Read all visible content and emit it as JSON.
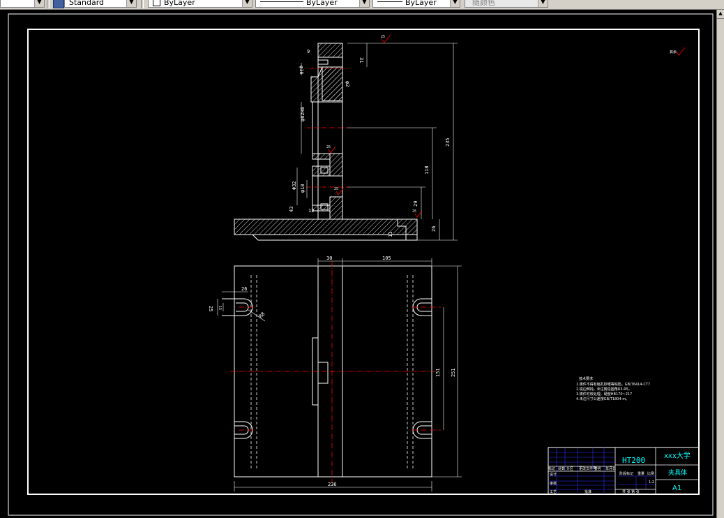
{
  "toolbar": {
    "textstyle_value": "Standard",
    "layer_value": "ByLayer",
    "linetype_value": "ByLayer",
    "lineweight_value": "ByLayer",
    "plotstyle_value": "随颜色"
  },
  "colors": {
    "background": "#000000",
    "frame": "#ffffff",
    "centerline": "#ff0000",
    "titleblock": "#0000ff",
    "text_cyan": "#00ffff",
    "dimension": "#ffffff"
  },
  "drawing": {
    "top_view_dims": {
      "d9": "9",
      "d31": "31",
      "d16": "φ16",
      "d2": "φ2",
      "d62": "φ62H8",
      "d235": "235",
      "d118": "118",
      "d1": "Φ32",
      "d10": "φ10",
      "d29": "29",
      "d43": "43",
      "d12": "12",
      "d26": "26",
      "d11": "11",
      "r25a": "25",
      "r25b": "25",
      "r25c": "25",
      "r25d": "25"
    },
    "bottom_view_dims": {
      "d30": "30",
      "d105": "105",
      "d26": "26",
      "d25": "25",
      "d15": "15",
      "r13": "R8",
      "d151": "151",
      "d251": "251",
      "d236": "236"
    },
    "roughness_label": "其余",
    "notes": {
      "heading": "技术要求",
      "line1": "1.铸件不得有缩孔砂眼等缺陷，GB/T6414-CT7",
      "line2": "2.锐边倒钝，未注铸造圆角R3-R5。",
      "line3": "3.铸件时效处理，硬度HB170~217",
      "line4": "4.未注尺寸公差按GB/T1804-m。"
    }
  },
  "title_block": {
    "material": "HT200",
    "school": "xxx大学",
    "part_name": "夹具体",
    "sheet_size": "A1",
    "scale": "1:2",
    "marks": [
      "标记",
      "处数",
      "分区",
      "更改文件号",
      "签名",
      "年月日"
    ],
    "rows": [
      "设计",
      "审核",
      "工艺",
      "批准"
    ],
    "stage_label": "阶段标记",
    "weight_label": "重量",
    "scale_label": "比例",
    "sheet_label": "共 张 第 张"
  }
}
